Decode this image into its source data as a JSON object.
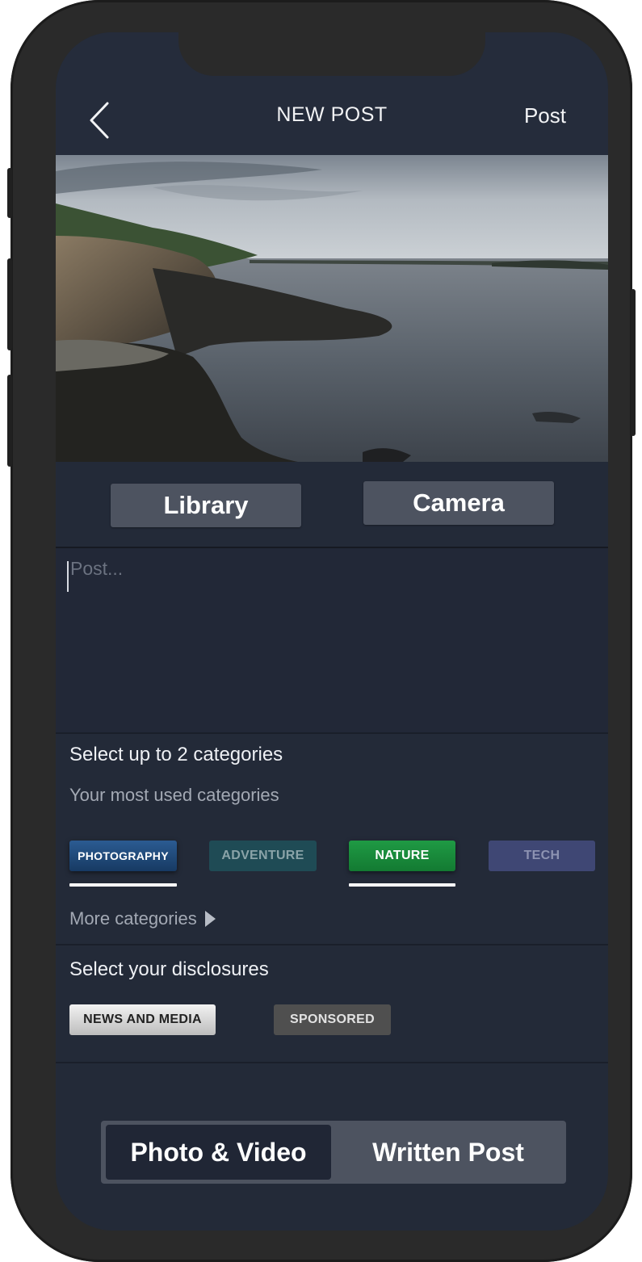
{
  "header": {
    "title": "NEW POST",
    "post_label": "Post"
  },
  "media": {
    "library_label": "Library",
    "camera_label": "Camera"
  },
  "compose": {
    "placeholder": "Post..."
  },
  "categories": {
    "heading": "Select up to 2 categories",
    "subheading": "Your most used categories",
    "items": [
      {
        "label": "PHOTOGRAPHY",
        "selected": true,
        "color": "#1e4a7a"
      },
      {
        "label": "ADVENTURE",
        "selected": false,
        "color": "#1f4b55"
      },
      {
        "label": "NATURE",
        "selected": true,
        "color": "#1a8a3c"
      },
      {
        "label": "TECH",
        "selected": false,
        "color": "#3f4774"
      }
    ],
    "more_label": "More categories"
  },
  "disclosures": {
    "heading": "Select your disclosures",
    "items": [
      {
        "label": "NEWS AND MEDIA",
        "selected": true
      },
      {
        "label": "SPONSORED",
        "selected": false
      }
    ]
  },
  "post_type": {
    "options": [
      "Photo & Video",
      "Written Post"
    ],
    "active": "Photo & Video"
  }
}
